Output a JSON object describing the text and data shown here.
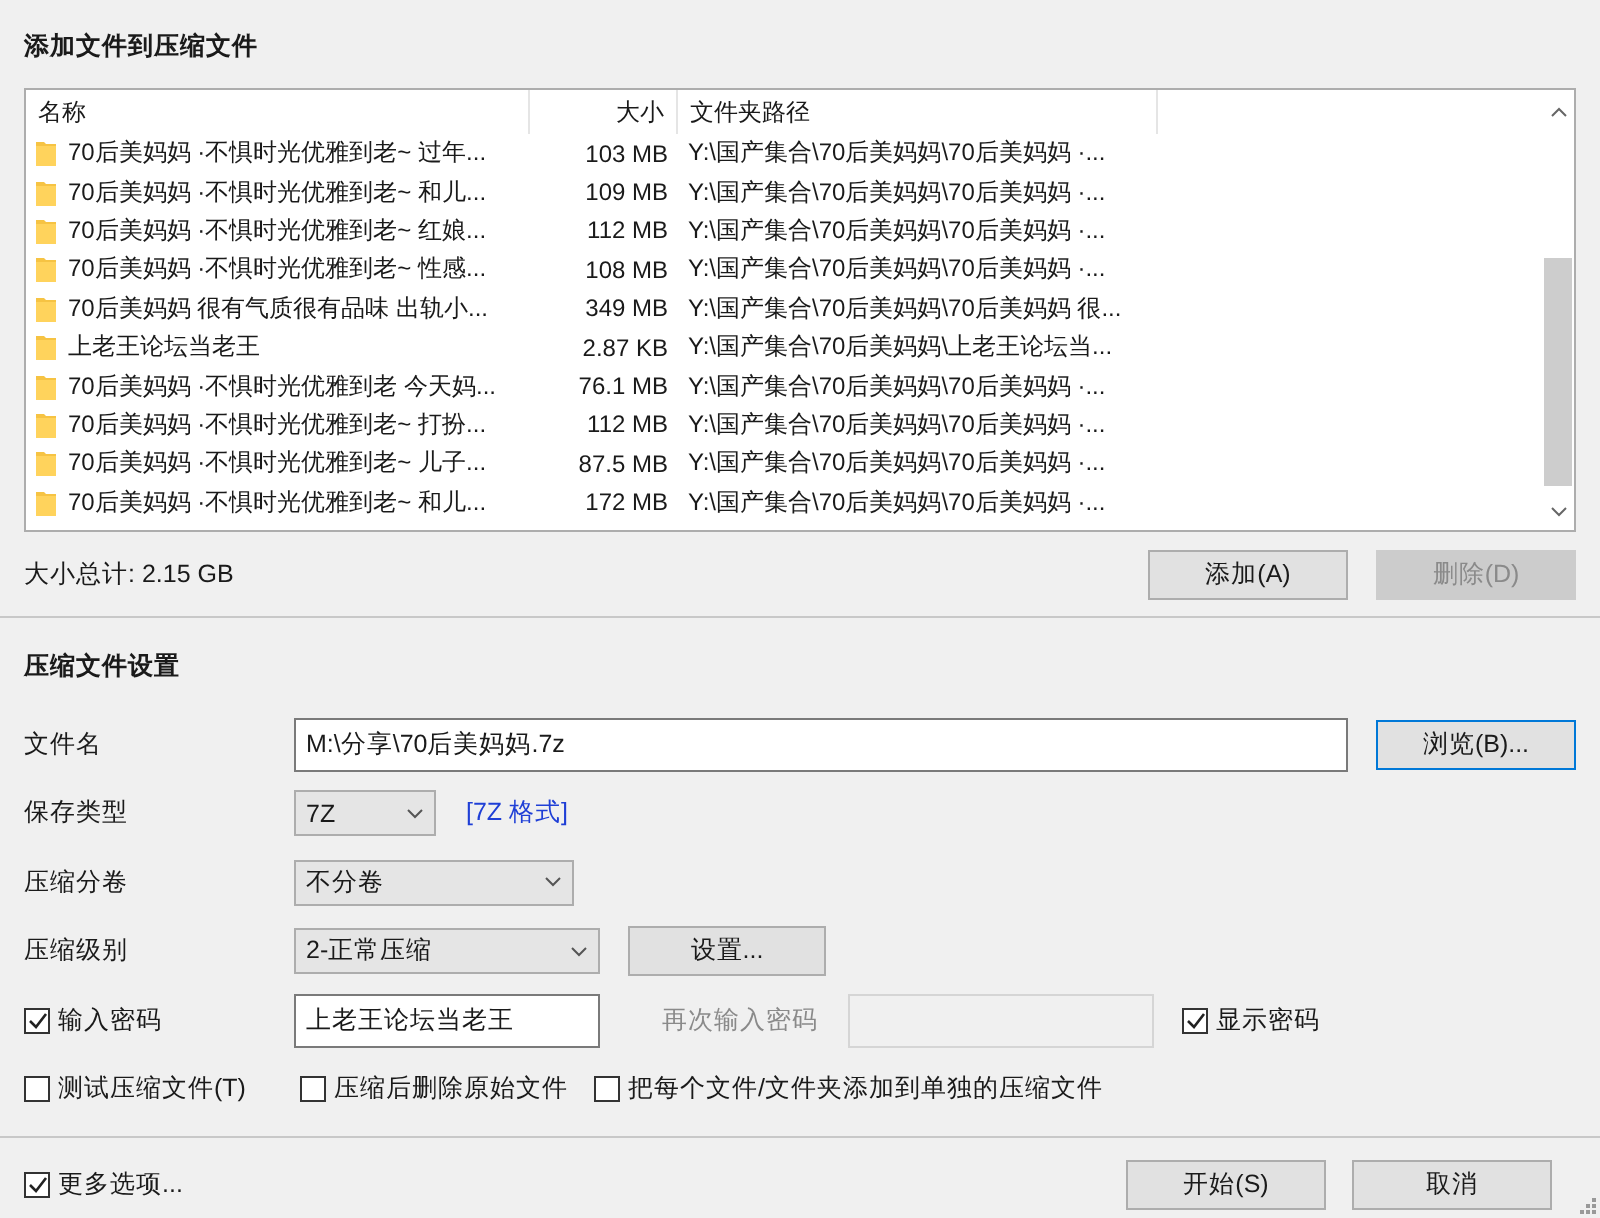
{
  "files_section": {
    "title": "添加文件到压缩文件",
    "columns": [
      "名称",
      "大小",
      "文件夹路径"
    ],
    "rows": [
      {
        "name": "70后美妈妈 ·不惧时光优雅到老~ 过年...",
        "size": "103 MB",
        "path": "Y:\\国产集合\\70后美妈妈\\70后美妈妈 ·..."
      },
      {
        "name": "70后美妈妈 ·不惧时光优雅到老~ 和儿...",
        "size": "109 MB",
        "path": "Y:\\国产集合\\70后美妈妈\\70后美妈妈 ·..."
      },
      {
        "name": "70后美妈妈 ·不惧时光优雅到老~ 红娘...",
        "size": "112 MB",
        "path": "Y:\\国产集合\\70后美妈妈\\70后美妈妈 ·..."
      },
      {
        "name": "70后美妈妈 ·不惧时光优雅到老~ 性感...",
        "size": "108 MB",
        "path": "Y:\\国产集合\\70后美妈妈\\70后美妈妈 ·..."
      },
      {
        "name": "70后美妈妈 很有气质很有品味  出轨小...",
        "size": "349 MB",
        "path": "Y:\\国产集合\\70后美妈妈\\70后美妈妈 很..."
      },
      {
        "name": "上老王论坛当老王",
        "size": "2.87 KB",
        "path": "Y:\\国产集合\\70后美妈妈\\上老王论坛当..."
      },
      {
        "name": "70后美妈妈 ·不惧时光优雅到老  今天妈...",
        "size": "76.1 MB",
        "path": "Y:\\国产集合\\70后美妈妈\\70后美妈妈 ·..."
      },
      {
        "name": "70后美妈妈 ·不惧时光优雅到老~  打扮...",
        "size": "112 MB",
        "path": "Y:\\国产集合\\70后美妈妈\\70后美妈妈 ·..."
      },
      {
        "name": "70后美妈妈 ·不惧时光优雅到老~  儿子...",
        "size": "87.5 MB",
        "path": "Y:\\国产集合\\70后美妈妈\\70后美妈妈 ·..."
      },
      {
        "name": "70后美妈妈 ·不惧时光优雅到老~  和儿...",
        "size": "172 MB",
        "path": "Y:\\国产集合\\70后美妈妈\\70后美妈妈 ·..."
      }
    ],
    "total": "大小总计: 2.15 GB",
    "buttons": [
      {
        "label": "添加(A)",
        "disabled": false
      },
      {
        "label": "删除(D)",
        "disabled": true
      }
    ]
  },
  "settings": {
    "title": "压缩文件设置",
    "filename": {
      "label": "文件名",
      "value": "M:\\分享\\70后美妈妈.7z",
      "browse": "浏览(B)..."
    },
    "type": {
      "label": "保存类型",
      "value": "7Z",
      "link": "[7Z 格式]"
    },
    "split": {
      "label": "压缩分卷",
      "value": "不分卷"
    },
    "level": {
      "label": "压缩级别",
      "value": "2-正常压缩",
      "settings_button": "设置..."
    },
    "password": {
      "label": "输入密码",
      "checked": true,
      "value": "上老王论坛当老王",
      "repeat_label": "再次输入密码",
      "repeat_disabled": true,
      "show_label": "显示密码",
      "show_checked": true
    },
    "options": [
      {
        "label": "测试压缩文件(T)",
        "checked": false
      },
      {
        "label": "压缩后删除原始文件",
        "checked": false
      },
      {
        "label": "把每个文件/文件夹添加到单独的压缩文件",
        "checked": false
      }
    ]
  },
  "footer": {
    "more_options": {
      "label": "更多选项...",
      "checked": true
    },
    "buttons": [
      "开始(S)",
      "取消"
    ]
  }
}
